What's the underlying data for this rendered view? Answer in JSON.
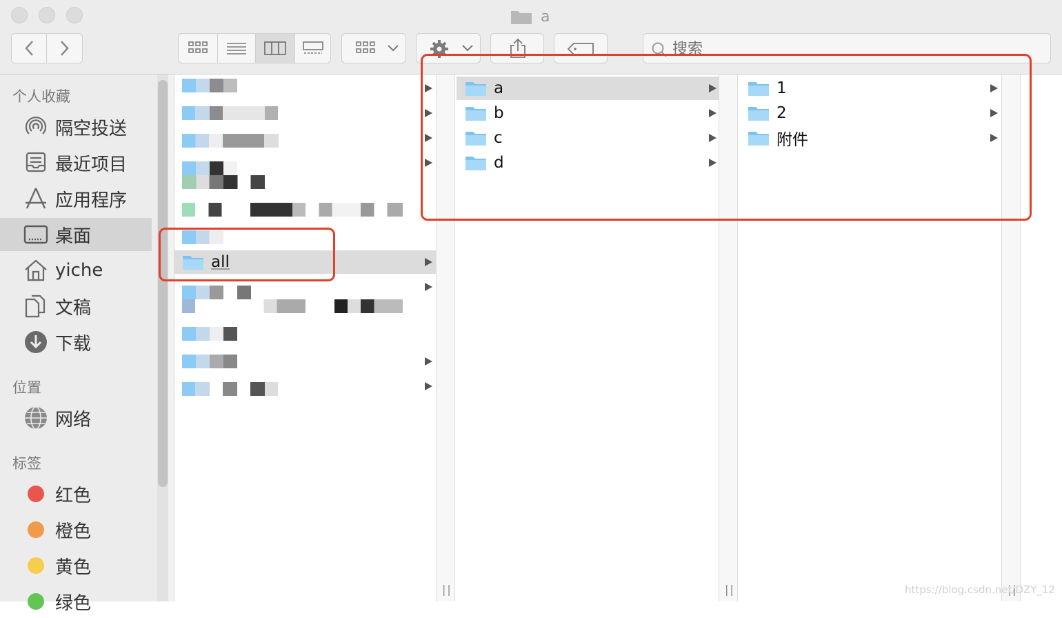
{
  "window": {
    "title": "a"
  },
  "toolbar": {
    "view_buttons": [
      "icon-view",
      "list-view",
      "column-view",
      "gallery-view"
    ],
    "search": {
      "placeholder": "搜索"
    }
  },
  "sidebar": {
    "favorites_header": "个人收藏",
    "favorites": [
      {
        "label": "隔空投送",
        "icon": "airdrop-icon"
      },
      {
        "label": "最近项目",
        "icon": "recents-icon"
      },
      {
        "label": "应用程序",
        "icon": "applications-icon"
      },
      {
        "label": "桌面",
        "icon": "desktop-icon",
        "selected": true
      },
      {
        "label": "yiche",
        "icon": "home-icon"
      },
      {
        "label": "文稿",
        "icon": "documents-icon"
      },
      {
        "label": "下载",
        "icon": "downloads-icon"
      }
    ],
    "locations_header": "位置",
    "locations": [
      {
        "label": "网络",
        "icon": "network-icon"
      }
    ],
    "tags_header": "标签",
    "tags": [
      {
        "label": "红色",
        "color": "#e8564d"
      },
      {
        "label": "橙色",
        "color": "#f09a4a"
      },
      {
        "label": "黄色",
        "color": "#f6cd4f"
      },
      {
        "label": "绿色",
        "color": "#62c554"
      }
    ]
  },
  "columns": {
    "col1": {
      "selected_item": "all"
    },
    "col2": {
      "items": [
        "a",
        "b",
        "c",
        "d"
      ],
      "selected": "a"
    },
    "col3": {
      "items": [
        "1",
        "2",
        "附件"
      ]
    }
  },
  "colors": {
    "folder": "#7cc3f2",
    "annotation": "#e0402a",
    "selection": "#dcdcdc"
  },
  "watermark": "https://blog.csdn.net/DZY_12"
}
